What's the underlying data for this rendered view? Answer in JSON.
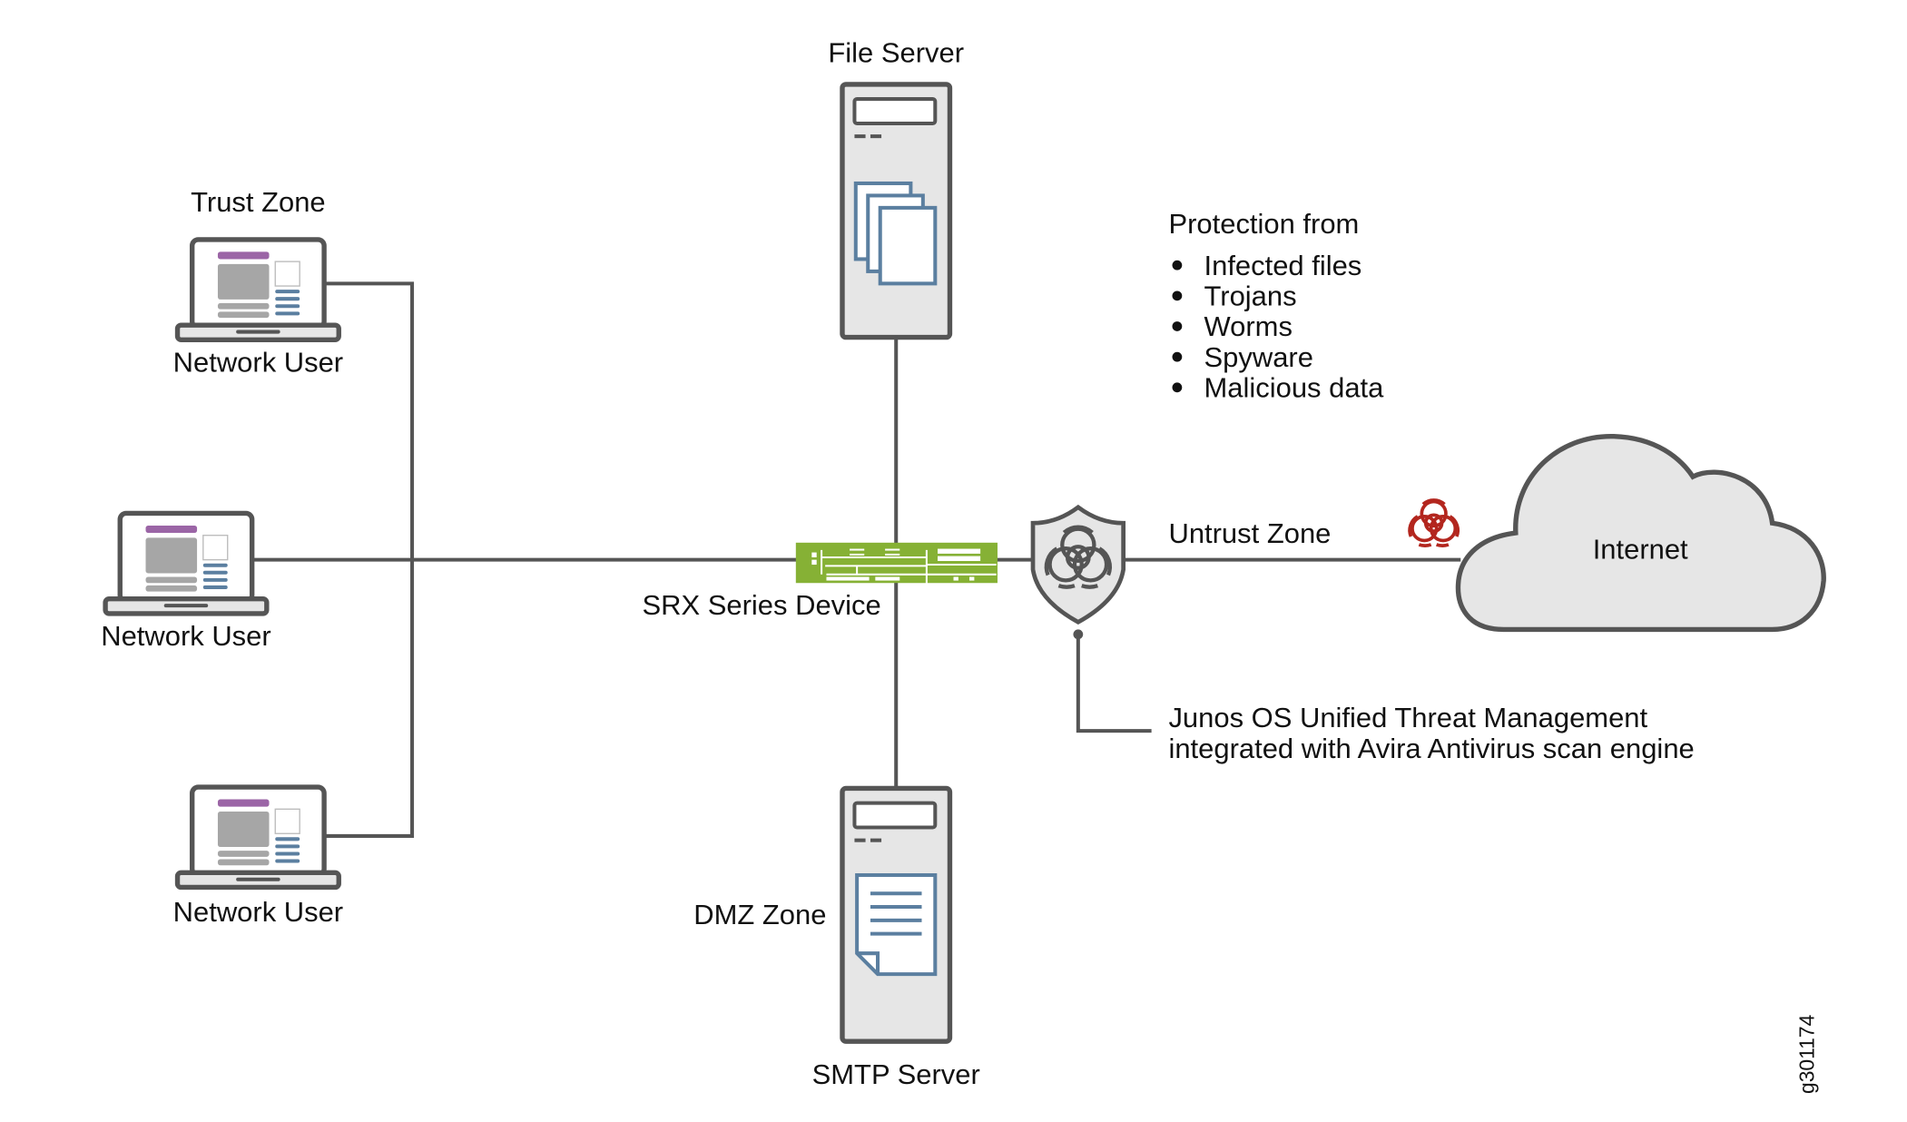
{
  "labels": {
    "file_server": "File Server",
    "trust_zone": "Trust Zone",
    "network_user_1": "Network User",
    "network_user_2": "Network User",
    "network_user_3": "Network User",
    "srx_device": "SRX Series Device",
    "untrust_zone": "Untrust Zone",
    "internet": "Internet",
    "dmz_zone": "DMZ Zone",
    "smtp_server": "SMTP Server",
    "figure_id": "g301174"
  },
  "protection": {
    "heading": "Protection from",
    "items": [
      "Infected files",
      "Trojans",
      "Worms",
      "Spyware",
      "Malicious data"
    ]
  },
  "annotation": {
    "line1": "Junos OS Unified Threat Management",
    "line2": "integrated with Avira Antivirus scan engine"
  },
  "colors": {
    "line": "#555555",
    "device_fill": "#e6e6e6",
    "srx_green": "#86b135",
    "laptop_header": "#9b65a6",
    "document_blue": "#5b7fa0",
    "biohazard_red": "#b3261e"
  },
  "icons": [
    "laptop-icon",
    "server-icon",
    "documents-icon",
    "switch-icon",
    "shield-biohazard-icon",
    "biohazard-icon",
    "cloud-icon"
  ]
}
